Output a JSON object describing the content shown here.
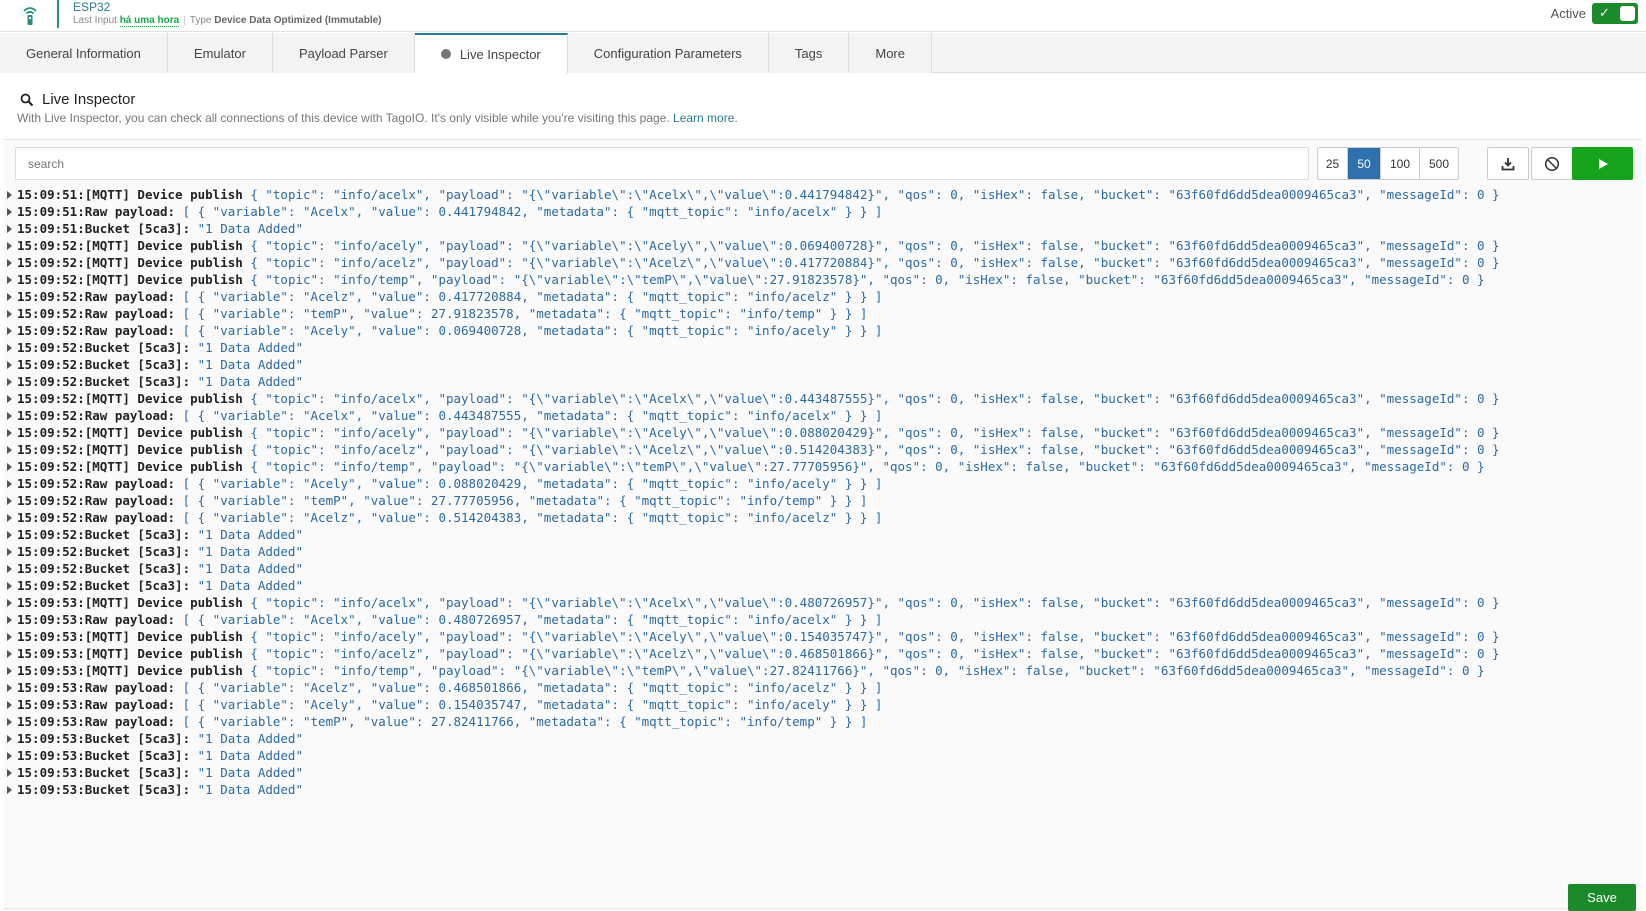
{
  "header": {
    "device_name": "ESP32",
    "last_input_label": "Last Input",
    "last_input_value": "há uma hora",
    "type_label": "Type",
    "type_value": "Device Data Optimized (Immutable)",
    "active_label": "Active",
    "active": true
  },
  "tabs": [
    {
      "label": "General Information"
    },
    {
      "label": "Emulator"
    },
    {
      "label": "Payload Parser"
    },
    {
      "label": "Live Inspector",
      "active": true
    },
    {
      "label": "Configuration Parameters"
    },
    {
      "label": "Tags"
    },
    {
      "label": "More"
    }
  ],
  "inspector": {
    "title": "Live Inspector",
    "description": "With Live Inspector, you can check all connections of this device with TagoIO. It's only visible while you're visiting this page.",
    "learn_more": "Learn more.",
    "search_placeholder": "search",
    "page_sizes": [
      "25",
      "50",
      "100",
      "500"
    ],
    "selected_page_size": "50",
    "icons": {
      "download": "download-icon",
      "clear": "block-icon",
      "play": "play-icon"
    },
    "colors": {
      "accent": "#2a7d93",
      "success": "#16a21a",
      "selected": "#2d70ad",
      "payload": "#2c6aa0"
    }
  },
  "log": [
    {
      "ts": "15:09:51:",
      "label": "[MQTT] Device publish",
      "payload": "{ \"topic\": \"info/acelx\", \"payload\": \"{\\\"variable\\\":\\\"Acelx\\\",\\\"value\\\":0.441794842}\", \"qos\": 0, \"isHex\": false, \"bucket\": \"63f60fd6dd5dea0009465ca3\", \"messageId\": 0 }"
    },
    {
      "ts": "15:09:51:",
      "label": "Raw payload:",
      "payload": "[ { \"variable\": \"Acelx\", \"value\": 0.441794842, \"metadata\": { \"mqtt_topic\": \"info/acelx\" } } ]"
    },
    {
      "ts": "15:09:51:",
      "label": "Bucket [5ca3]:",
      "payload": "\"1 Data Added\""
    },
    {
      "ts": "15:09:52:",
      "label": "[MQTT] Device publish",
      "payload": "{ \"topic\": \"info/acely\", \"payload\": \"{\\\"variable\\\":\\\"Acely\\\",\\\"value\\\":0.069400728}\", \"qos\": 0, \"isHex\": false, \"bucket\": \"63f60fd6dd5dea0009465ca3\", \"messageId\": 0 }"
    },
    {
      "ts": "15:09:52:",
      "label": "[MQTT] Device publish",
      "payload": "{ \"topic\": \"info/acelz\", \"payload\": \"{\\\"variable\\\":\\\"Acelz\\\",\\\"value\\\":0.417720884}\", \"qos\": 0, \"isHex\": false, \"bucket\": \"63f60fd6dd5dea0009465ca3\", \"messageId\": 0 }"
    },
    {
      "ts": "15:09:52:",
      "label": "[MQTT] Device publish",
      "payload": "{ \"topic\": \"info/temp\", \"payload\": \"{\\\"variable\\\":\\\"temP\\\",\\\"value\\\":27.91823578}\", \"qos\": 0, \"isHex\": false, \"bucket\": \"63f60fd6dd5dea0009465ca3\", \"messageId\": 0 }"
    },
    {
      "ts": "15:09:52:",
      "label": "Raw payload:",
      "payload": "[ { \"variable\": \"Acelz\", \"value\": 0.417720884, \"metadata\": { \"mqtt_topic\": \"info/acelz\" } } ]"
    },
    {
      "ts": "15:09:52:",
      "label": "Raw payload:",
      "payload": "[ { \"variable\": \"temP\", \"value\": 27.91823578, \"metadata\": { \"mqtt_topic\": \"info/temp\" } } ]"
    },
    {
      "ts": "15:09:52:",
      "label": "Raw payload:",
      "payload": "[ { \"variable\": \"Acely\", \"value\": 0.069400728, \"metadata\": { \"mqtt_topic\": \"info/acely\" } } ]"
    },
    {
      "ts": "15:09:52:",
      "label": "Bucket [5ca3]:",
      "payload": "\"1 Data Added\""
    },
    {
      "ts": "15:09:52:",
      "label": "Bucket [5ca3]:",
      "payload": "\"1 Data Added\""
    },
    {
      "ts": "15:09:52:",
      "label": "Bucket [5ca3]:",
      "payload": "\"1 Data Added\""
    },
    {
      "ts": "15:09:52:",
      "label": "[MQTT] Device publish",
      "payload": "{ \"topic\": \"info/acelx\", \"payload\": \"{\\\"variable\\\":\\\"Acelx\\\",\\\"value\\\":0.443487555}\", \"qos\": 0, \"isHex\": false, \"bucket\": \"63f60fd6dd5dea0009465ca3\", \"messageId\": 0 }"
    },
    {
      "ts": "15:09:52:",
      "label": "Raw payload:",
      "payload": "[ { \"variable\": \"Acelx\", \"value\": 0.443487555, \"metadata\": { \"mqtt_topic\": \"info/acelx\" } } ]"
    },
    {
      "ts": "15:09:52:",
      "label": "[MQTT] Device publish",
      "payload": "{ \"topic\": \"info/acely\", \"payload\": \"{\\\"variable\\\":\\\"Acely\\\",\\\"value\\\":0.088020429}\", \"qos\": 0, \"isHex\": false, \"bucket\": \"63f60fd6dd5dea0009465ca3\", \"messageId\": 0 }"
    },
    {
      "ts": "15:09:52:",
      "label": "[MQTT] Device publish",
      "payload": "{ \"topic\": \"info/acelz\", \"payload\": \"{\\\"variable\\\":\\\"Acelz\\\",\\\"value\\\":0.514204383}\", \"qos\": 0, \"isHex\": false, \"bucket\": \"63f60fd6dd5dea0009465ca3\", \"messageId\": 0 }"
    },
    {
      "ts": "15:09:52:",
      "label": "[MQTT] Device publish",
      "payload": "{ \"topic\": \"info/temp\", \"payload\": \"{\\\"variable\\\":\\\"temP\\\",\\\"value\\\":27.77705956}\", \"qos\": 0, \"isHex\": false, \"bucket\": \"63f60fd6dd5dea0009465ca3\", \"messageId\": 0 }"
    },
    {
      "ts": "15:09:52:",
      "label": "Raw payload:",
      "payload": "[ { \"variable\": \"Acely\", \"value\": 0.088020429, \"metadata\": { \"mqtt_topic\": \"info/acely\" } } ]"
    },
    {
      "ts": "15:09:52:",
      "label": "Raw payload:",
      "payload": "[ { \"variable\": \"temP\", \"value\": 27.77705956, \"metadata\": { \"mqtt_topic\": \"info/temp\" } } ]"
    },
    {
      "ts": "15:09:52:",
      "label": "Raw payload:",
      "payload": "[ { \"variable\": \"Acelz\", \"value\": 0.514204383, \"metadata\": { \"mqtt_topic\": \"info/acelz\" } } ]"
    },
    {
      "ts": "15:09:52:",
      "label": "Bucket [5ca3]:",
      "payload": "\"1 Data Added\""
    },
    {
      "ts": "15:09:52:",
      "label": "Bucket [5ca3]:",
      "payload": "\"1 Data Added\""
    },
    {
      "ts": "15:09:52:",
      "label": "Bucket [5ca3]:",
      "payload": "\"1 Data Added\""
    },
    {
      "ts": "15:09:52:",
      "label": "Bucket [5ca3]:",
      "payload": "\"1 Data Added\""
    },
    {
      "ts": "15:09:53:",
      "label": "[MQTT] Device publish",
      "payload": "{ \"topic\": \"info/acelx\", \"payload\": \"{\\\"variable\\\":\\\"Acelx\\\",\\\"value\\\":0.480726957}\", \"qos\": 0, \"isHex\": false, \"bucket\": \"63f60fd6dd5dea0009465ca3\", \"messageId\": 0 }"
    },
    {
      "ts": "15:09:53:",
      "label": "Raw payload:",
      "payload": "[ { \"variable\": \"Acelx\", \"value\": 0.480726957, \"metadata\": { \"mqtt_topic\": \"info/acelx\" } } ]"
    },
    {
      "ts": "15:09:53:",
      "label": "[MQTT] Device publish",
      "payload": "{ \"topic\": \"info/acely\", \"payload\": \"{\\\"variable\\\":\\\"Acely\\\",\\\"value\\\":0.154035747}\", \"qos\": 0, \"isHex\": false, \"bucket\": \"63f60fd6dd5dea0009465ca3\", \"messageId\": 0 }"
    },
    {
      "ts": "15:09:53:",
      "label": "[MQTT] Device publish",
      "payload": "{ \"topic\": \"info/acelz\", \"payload\": \"{\\\"variable\\\":\\\"Acelz\\\",\\\"value\\\":0.468501866}\", \"qos\": 0, \"isHex\": false, \"bucket\": \"63f60fd6dd5dea0009465ca3\", \"messageId\": 0 }"
    },
    {
      "ts": "15:09:53:",
      "label": "[MQTT] Device publish",
      "payload": "{ \"topic\": \"info/temp\", \"payload\": \"{\\\"variable\\\":\\\"temP\\\",\\\"value\\\":27.82411766}\", \"qos\": 0, \"isHex\": false, \"bucket\": \"63f60fd6dd5dea0009465ca3\", \"messageId\": 0 }"
    },
    {
      "ts": "15:09:53:",
      "label": "Raw payload:",
      "payload": "[ { \"variable\": \"Acelz\", \"value\": 0.468501866, \"metadata\": { \"mqtt_topic\": \"info/acelz\" } } ]"
    },
    {
      "ts": "15:09:53:",
      "label": "Raw payload:",
      "payload": "[ { \"variable\": \"Acely\", \"value\": 0.154035747, \"metadata\": { \"mqtt_topic\": \"info/acely\" } } ]"
    },
    {
      "ts": "15:09:53:",
      "label": "Raw payload:",
      "payload": "[ { \"variable\": \"temP\", \"value\": 27.82411766, \"metadata\": { \"mqtt_topic\": \"info/temp\" } } ]"
    },
    {
      "ts": "15:09:53:",
      "label": "Bucket [5ca3]:",
      "payload": "\"1 Data Added\""
    },
    {
      "ts": "15:09:53:",
      "label": "Bucket [5ca3]:",
      "payload": "\"1 Data Added\""
    },
    {
      "ts": "15:09:53:",
      "label": "Bucket [5ca3]:",
      "payload": "\"1 Data Added\""
    },
    {
      "ts": "15:09:53:",
      "label": "Bucket [5ca3]:",
      "payload": "\"1 Data Added\""
    }
  ],
  "footer": {
    "save_label": "Save"
  }
}
